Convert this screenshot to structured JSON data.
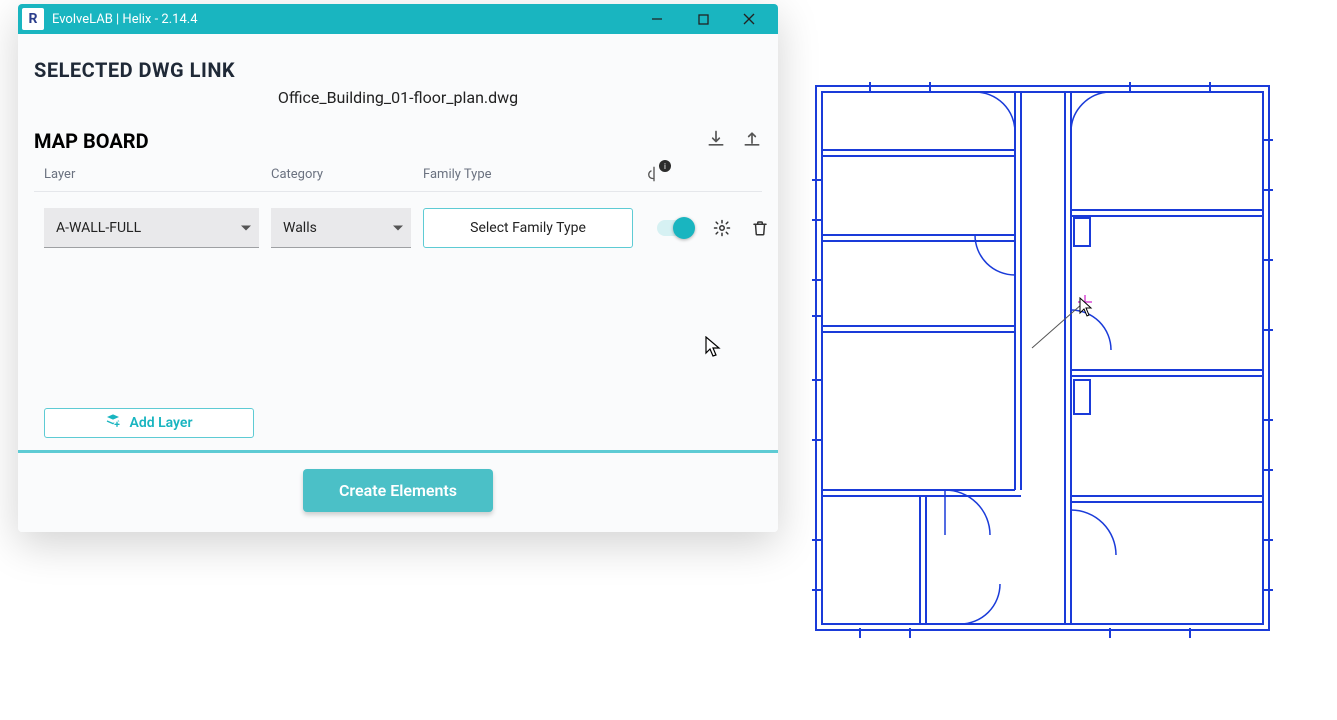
{
  "window": {
    "app_icon_letter": "R",
    "title": "EvolveLAB | Helix - 2.14.4"
  },
  "section": {
    "selected_dwg_heading": "SELECTED DWG LINK",
    "filename": "Office_Building_01-floor_plan.dwg",
    "map_board_heading": "MAP BOARD"
  },
  "columns": {
    "layer": "Layer",
    "category": "Category",
    "family_type": "Family Type",
    "centerline_badge": "i"
  },
  "row": {
    "layer_value": "A-WALL-FULL",
    "category_value": "Walls",
    "family_type_label": "Select Family Type"
  },
  "buttons": {
    "add_layer": "Add Layer",
    "create_elements": "Create Elements"
  }
}
